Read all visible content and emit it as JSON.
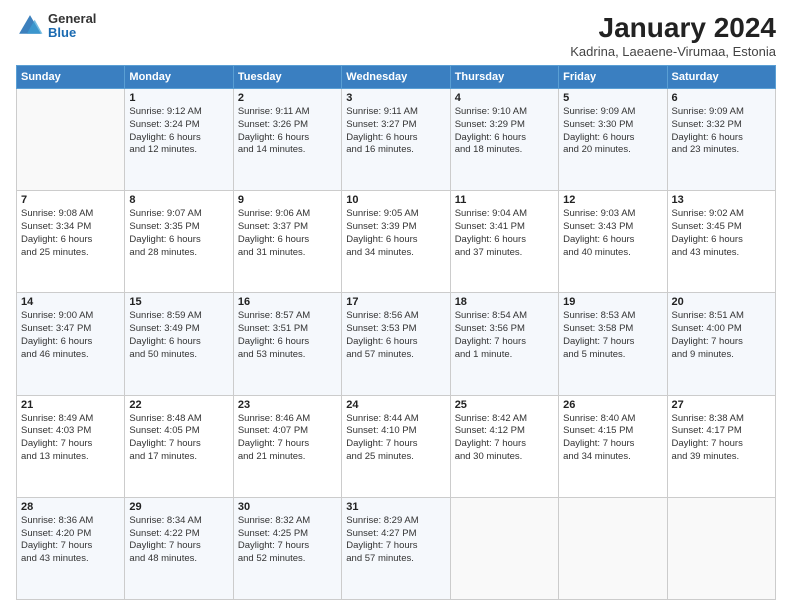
{
  "header": {
    "logo_general": "General",
    "logo_blue": "Blue",
    "month": "January 2024",
    "location": "Kadrina, Laeaene-Virumaa, Estonia"
  },
  "weekdays": [
    "Sunday",
    "Monday",
    "Tuesday",
    "Wednesday",
    "Thursday",
    "Friday",
    "Saturday"
  ],
  "weeks": [
    [
      {
        "day": "",
        "info": ""
      },
      {
        "day": "1",
        "info": "Sunrise: 9:12 AM\nSunset: 3:24 PM\nDaylight: 6 hours\nand 12 minutes."
      },
      {
        "day": "2",
        "info": "Sunrise: 9:11 AM\nSunset: 3:26 PM\nDaylight: 6 hours\nand 14 minutes."
      },
      {
        "day": "3",
        "info": "Sunrise: 9:11 AM\nSunset: 3:27 PM\nDaylight: 6 hours\nand 16 minutes."
      },
      {
        "day": "4",
        "info": "Sunrise: 9:10 AM\nSunset: 3:29 PM\nDaylight: 6 hours\nand 18 minutes."
      },
      {
        "day": "5",
        "info": "Sunrise: 9:09 AM\nSunset: 3:30 PM\nDaylight: 6 hours\nand 20 minutes."
      },
      {
        "day": "6",
        "info": "Sunrise: 9:09 AM\nSunset: 3:32 PM\nDaylight: 6 hours\nand 23 minutes."
      }
    ],
    [
      {
        "day": "7",
        "info": "Sunrise: 9:08 AM\nSunset: 3:34 PM\nDaylight: 6 hours\nand 25 minutes."
      },
      {
        "day": "8",
        "info": "Sunrise: 9:07 AM\nSunset: 3:35 PM\nDaylight: 6 hours\nand 28 minutes."
      },
      {
        "day": "9",
        "info": "Sunrise: 9:06 AM\nSunset: 3:37 PM\nDaylight: 6 hours\nand 31 minutes."
      },
      {
        "day": "10",
        "info": "Sunrise: 9:05 AM\nSunset: 3:39 PM\nDaylight: 6 hours\nand 34 minutes."
      },
      {
        "day": "11",
        "info": "Sunrise: 9:04 AM\nSunset: 3:41 PM\nDaylight: 6 hours\nand 37 minutes."
      },
      {
        "day": "12",
        "info": "Sunrise: 9:03 AM\nSunset: 3:43 PM\nDaylight: 6 hours\nand 40 minutes."
      },
      {
        "day": "13",
        "info": "Sunrise: 9:02 AM\nSunset: 3:45 PM\nDaylight: 6 hours\nand 43 minutes."
      }
    ],
    [
      {
        "day": "14",
        "info": "Sunrise: 9:00 AM\nSunset: 3:47 PM\nDaylight: 6 hours\nand 46 minutes."
      },
      {
        "day": "15",
        "info": "Sunrise: 8:59 AM\nSunset: 3:49 PM\nDaylight: 6 hours\nand 50 minutes."
      },
      {
        "day": "16",
        "info": "Sunrise: 8:57 AM\nSunset: 3:51 PM\nDaylight: 6 hours\nand 53 minutes."
      },
      {
        "day": "17",
        "info": "Sunrise: 8:56 AM\nSunset: 3:53 PM\nDaylight: 6 hours\nand 57 minutes."
      },
      {
        "day": "18",
        "info": "Sunrise: 8:54 AM\nSunset: 3:56 PM\nDaylight: 7 hours\nand 1 minute."
      },
      {
        "day": "19",
        "info": "Sunrise: 8:53 AM\nSunset: 3:58 PM\nDaylight: 7 hours\nand 5 minutes."
      },
      {
        "day": "20",
        "info": "Sunrise: 8:51 AM\nSunset: 4:00 PM\nDaylight: 7 hours\nand 9 minutes."
      }
    ],
    [
      {
        "day": "21",
        "info": "Sunrise: 8:49 AM\nSunset: 4:03 PM\nDaylight: 7 hours\nand 13 minutes."
      },
      {
        "day": "22",
        "info": "Sunrise: 8:48 AM\nSunset: 4:05 PM\nDaylight: 7 hours\nand 17 minutes."
      },
      {
        "day": "23",
        "info": "Sunrise: 8:46 AM\nSunset: 4:07 PM\nDaylight: 7 hours\nand 21 minutes."
      },
      {
        "day": "24",
        "info": "Sunrise: 8:44 AM\nSunset: 4:10 PM\nDaylight: 7 hours\nand 25 minutes."
      },
      {
        "day": "25",
        "info": "Sunrise: 8:42 AM\nSunset: 4:12 PM\nDaylight: 7 hours\nand 30 minutes."
      },
      {
        "day": "26",
        "info": "Sunrise: 8:40 AM\nSunset: 4:15 PM\nDaylight: 7 hours\nand 34 minutes."
      },
      {
        "day": "27",
        "info": "Sunrise: 8:38 AM\nSunset: 4:17 PM\nDaylight: 7 hours\nand 39 minutes."
      }
    ],
    [
      {
        "day": "28",
        "info": "Sunrise: 8:36 AM\nSunset: 4:20 PM\nDaylight: 7 hours\nand 43 minutes."
      },
      {
        "day": "29",
        "info": "Sunrise: 8:34 AM\nSunset: 4:22 PM\nDaylight: 7 hours\nand 48 minutes."
      },
      {
        "day": "30",
        "info": "Sunrise: 8:32 AM\nSunset: 4:25 PM\nDaylight: 7 hours\nand 52 minutes."
      },
      {
        "day": "31",
        "info": "Sunrise: 8:29 AM\nSunset: 4:27 PM\nDaylight: 7 hours\nand 57 minutes."
      },
      {
        "day": "",
        "info": ""
      },
      {
        "day": "",
        "info": ""
      },
      {
        "day": "",
        "info": ""
      }
    ]
  ]
}
